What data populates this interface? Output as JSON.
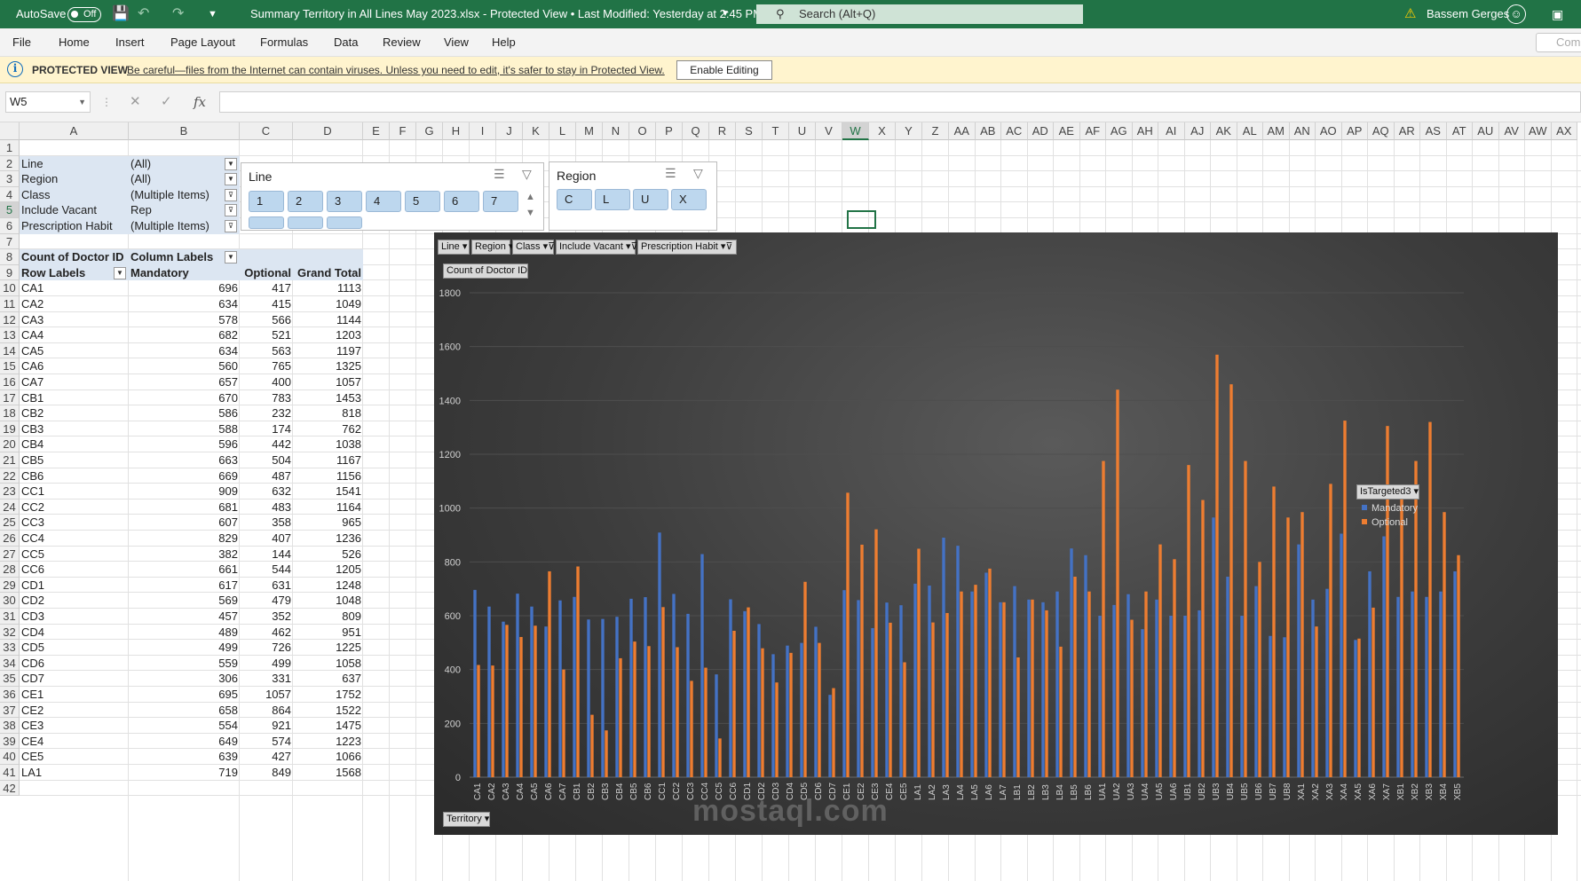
{
  "titlebar": {
    "autosave_label": "AutoSave",
    "autosave_state": "Off",
    "title": "Summary Territory in All Lines May 2023.xlsx  -  Protected View • Last Modified: Yesterday at 2:45 PM",
    "search_placeholder": "Search (Alt+Q)",
    "warning_icon": "warning-icon",
    "user": "Bassem Gerges"
  },
  "menu": [
    "File",
    "Home",
    "Insert",
    "Page Layout",
    "Formulas",
    "Data",
    "Review",
    "View",
    "Help"
  ],
  "comments_label": "Com",
  "protected": {
    "label": "PROTECTED VIEW",
    "message": "Be careful—files from the Internet can contain viruses. Unless you need to edit, it's safer to stay in Protected View.",
    "button": "Enable Editing"
  },
  "namebox": "W5",
  "columns": [
    "A",
    "B",
    "C",
    "D",
    "E",
    "F",
    "G",
    "H",
    "I",
    "J",
    "K",
    "L",
    "M",
    "N",
    "O",
    "P",
    "Q",
    "R",
    "S",
    "T",
    "U",
    "V",
    "W",
    "X",
    "Y",
    "Z",
    "AA",
    "AB",
    "AC",
    "AD",
    "AE",
    "AF",
    "AG",
    "AH",
    "AI",
    "AJ",
    "AK",
    "AL",
    "AM",
    "AN",
    "AO",
    "AP",
    "AQ",
    "AR",
    "AS",
    "AT",
    "AU",
    "AV",
    "AW",
    "AX"
  ],
  "filters": [
    {
      "label": "Line",
      "value": "(All)"
    },
    {
      "label": "Region",
      "value": "(All)"
    },
    {
      "label": "Class",
      "value": "(Multiple Items)"
    },
    {
      "label": "Include Vacant",
      "value": "Rep"
    },
    {
      "label": "Prescription Habit",
      "value": "(Multiple Items)"
    }
  ],
  "pivot": {
    "corner": "Count of Doctor ID",
    "col_labels": "Column Labels",
    "row_labels": "Row Labels",
    "headers": [
      "Mandatory",
      "Optional",
      "Grand Total"
    ],
    "rows": [
      [
        "CA1",
        "696",
        "417",
        "1113"
      ],
      [
        "CA2",
        "634",
        "415",
        "1049"
      ],
      [
        "CA3",
        "578",
        "566",
        "1144"
      ],
      [
        "CA4",
        "682",
        "521",
        "1203"
      ],
      [
        "CA5",
        "634",
        "563",
        "1197"
      ],
      [
        "CA6",
        "560",
        "765",
        "1325"
      ],
      [
        "CA7",
        "657",
        "400",
        "1057"
      ],
      [
        "CB1",
        "670",
        "783",
        "1453"
      ],
      [
        "CB2",
        "586",
        "232",
        "818"
      ],
      [
        "CB3",
        "588",
        "174",
        "762"
      ],
      [
        "CB4",
        "596",
        "442",
        "1038"
      ],
      [
        "CB5",
        "663",
        "504",
        "1167"
      ],
      [
        "CB6",
        "669",
        "487",
        "1156"
      ],
      [
        "CC1",
        "909",
        "632",
        "1541"
      ],
      [
        "CC2",
        "681",
        "483",
        "1164"
      ],
      [
        "CC3",
        "607",
        "358",
        "965"
      ],
      [
        "CC4",
        "829",
        "407",
        "1236"
      ],
      [
        "CC5",
        "382",
        "144",
        "526"
      ],
      [
        "CC6",
        "661",
        "544",
        "1205"
      ],
      [
        "CD1",
        "617",
        "631",
        "1248"
      ],
      [
        "CD2",
        "569",
        "479",
        "1048"
      ],
      [
        "CD3",
        "457",
        "352",
        "809"
      ],
      [
        "CD4",
        "489",
        "462",
        "951"
      ],
      [
        "CD5",
        "499",
        "726",
        "1225"
      ],
      [
        "CD6",
        "559",
        "499",
        "1058"
      ],
      [
        "CD7",
        "306",
        "331",
        "637"
      ],
      [
        "CE1",
        "695",
        "1057",
        "1752"
      ],
      [
        "CE2",
        "658",
        "864",
        "1522"
      ],
      [
        "CE3",
        "554",
        "921",
        "1475"
      ],
      [
        "CE4",
        "649",
        "574",
        "1223"
      ],
      [
        "CE5",
        "639",
        "427",
        "1066"
      ],
      [
        "LA1",
        "719",
        "849",
        "1568"
      ]
    ]
  },
  "slicer_line": {
    "title": "Line",
    "items": [
      "1",
      "2",
      "3",
      "4",
      "5",
      "6",
      "7"
    ]
  },
  "slicer_region": {
    "title": "Region",
    "items": [
      "C",
      "L",
      "U",
      "X"
    ]
  },
  "chart_buttons": [
    "Line",
    "Region",
    "Class",
    "Include Vacant",
    "Prescription Habit"
  ],
  "value_button": "Count of Doctor ID",
  "axis_button": "Territory",
  "legend_title": "IsTargeted3",
  "watermark": "mostaql.com",
  "chart_data": {
    "type": "bar",
    "ylim": [
      0,
      1800
    ],
    "yticks": [
      "0",
      "200",
      "400",
      "600",
      "800",
      "1000",
      "1200",
      "1400",
      "1600",
      "1800"
    ],
    "grid": true,
    "legend_position": "right",
    "categories": [
      "CA1",
      "CA2",
      "CA3",
      "CA4",
      "CA5",
      "CA6",
      "CA7",
      "CB1",
      "CB2",
      "CB3",
      "CB4",
      "CB5",
      "CB6",
      "CC1",
      "CC2",
      "CC3",
      "CC4",
      "CC5",
      "CC6",
      "CD1",
      "CD2",
      "CD3",
      "CD4",
      "CD5",
      "CD6",
      "CD7",
      "CE1",
      "CE2",
      "CE3",
      "CE4",
      "CE5",
      "LA1",
      "LA2",
      "LA3",
      "LA4",
      "LA5",
      "LA6",
      "LA7",
      "LB1",
      "LB2",
      "LB3",
      "LB4",
      "LB5",
      "LB6",
      "UA1",
      "UA2",
      "UA3",
      "UA4",
      "UA5",
      "UA6",
      "UB1",
      "UB2",
      "UB3",
      "UB4",
      "UB5",
      "UB6",
      "UB7",
      "UB8",
      "XA1",
      "XA2",
      "XA3",
      "XA4",
      "XA5",
      "XA6",
      "XA7",
      "XB1",
      "XB2",
      "XB3",
      "XB4",
      "XB5"
    ],
    "series": [
      {
        "name": "Mandatory",
        "color": "#4472c4",
        "values": [
          696,
          634,
          578,
          682,
          634,
          560,
          657,
          670,
          586,
          588,
          596,
          663,
          669,
          909,
          681,
          607,
          829,
          382,
          661,
          617,
          569,
          457,
          489,
          499,
          559,
          306,
          695,
          658,
          554,
          649,
          639,
          719,
          712,
          890,
          860,
          690,
          760,
          650,
          710,
          660,
          650,
          690,
          850,
          825,
          600,
          640,
          680,
          550,
          660,
          600,
          600,
          620,
          965,
          745,
          600,
          710,
          525,
          520,
          865,
          660,
          700,
          905,
          510,
          765,
          895,
          670,
          690,
          670,
          690,
          765
        ]
      },
      {
        "name": "Optional",
        "color": "#ed7d31",
        "values": [
          417,
          415,
          566,
          521,
          563,
          765,
          400,
          783,
          232,
          174,
          442,
          504,
          487,
          632,
          483,
          358,
          407,
          144,
          544,
          631,
          479,
          352,
          462,
          726,
          499,
          331,
          1057,
          864,
          921,
          574,
          427,
          849,
          575,
          610,
          690,
          715,
          775,
          650,
          445,
          660,
          620,
          485,
          745,
          690,
          1175,
          1440,
          585,
          690,
          865,
          810,
          1160,
          1030,
          1570,
          1460,
          1175,
          800,
          1080,
          965,
          985,
          560,
          1090,
          1325,
          515,
          630,
          1305,
          1045,
          1175,
          1320,
          985,
          825
        ]
      }
    ]
  }
}
